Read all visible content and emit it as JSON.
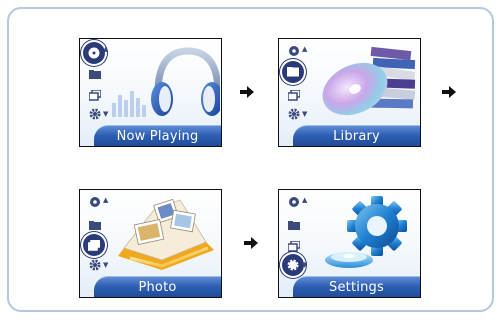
{
  "screens": [
    {
      "label": "Now Playing",
      "active_icon": "now-playing-icon",
      "art_icon": "headphones-icon"
    },
    {
      "label": "Library",
      "active_icon": "library-icon",
      "art_icon": "cd-stack-icon"
    },
    {
      "label": "Photo",
      "active_icon": "photo-icon",
      "art_icon": "photo-album-icon"
    },
    {
      "label": "Settings",
      "active_icon": "settings-icon",
      "art_icon": "gear-icon"
    }
  ],
  "flow_arrows": [
    "arrow-right-icon",
    "arrow-right-icon",
    "arrow-right-icon"
  ],
  "colors": {
    "frame_border": "#b7c7e0",
    "label_bar": "#2e5fb3",
    "active_icon_bg": "#2b3a78",
    "arrow": "#111111"
  }
}
